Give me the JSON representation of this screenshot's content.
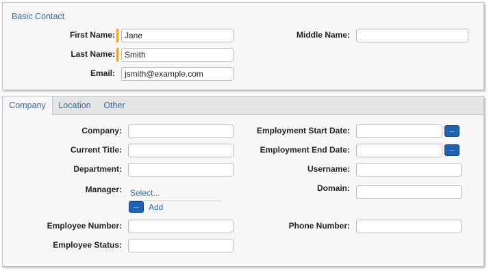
{
  "basic_contact": {
    "title": "Basic Contact",
    "first_name_label": "First Name:",
    "first_name_value": "Jane",
    "last_name_label": "Last Name:",
    "last_name_value": "Smith",
    "email_label": "Email:",
    "email_value": "jsmith@example.com",
    "middle_name_label": "Middle Name:",
    "middle_name_value": ""
  },
  "tabs": [
    "Company",
    "Location",
    "Other"
  ],
  "company": {
    "company_label": "Company:",
    "current_title_label": "Current Title:",
    "department_label": "Department:",
    "manager_label": "Manager:",
    "manager_select": "Select...",
    "manager_button": "...",
    "manager_add": "Add",
    "employee_number_label": "Employee Number:",
    "employee_status_label": "Employee Status:",
    "employment_start_label": "Employment Start Date:",
    "employment_start_button": "...",
    "employment_end_label": "Employment End Date:",
    "employment_end_button": "...",
    "username_label": "Username:",
    "domain_label": "Domain:",
    "phone_number_label": "Phone Number:"
  },
  "colors": {
    "required_marker": "#f0a024",
    "accent": "#2e6aa8",
    "button": "#1f62b4"
  }
}
